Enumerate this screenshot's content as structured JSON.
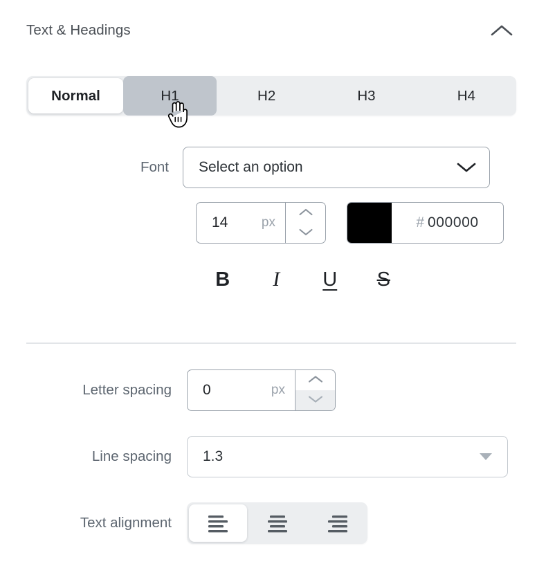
{
  "header": {
    "title": "Text & Headings",
    "collapse_icon": "chevron-up-icon"
  },
  "heading_tabs": {
    "items": [
      {
        "label": "Normal",
        "state": "active"
      },
      {
        "label": "H1",
        "state": "hover"
      },
      {
        "label": "H2",
        "state": "default"
      },
      {
        "label": "H3",
        "state": "default"
      },
      {
        "label": "H4",
        "state": "default"
      }
    ]
  },
  "font": {
    "label": "Font",
    "selected": "Select an option",
    "placeholder": "Select an option",
    "chevron_icon": "chevron-down-icon"
  },
  "font_size": {
    "value": "14",
    "unit": "px",
    "increment_icon": "chevron-up-icon",
    "decrement_icon": "chevron-down-icon"
  },
  "font_color": {
    "swatch": "#000000",
    "hash": "#",
    "hex": "000000"
  },
  "format_buttons": [
    {
      "name": "bold-button",
      "label": "B"
    },
    {
      "name": "italic-button",
      "label": "I"
    },
    {
      "name": "underline-button",
      "label": "U"
    },
    {
      "name": "strikethrough-button",
      "label": "S"
    }
  ],
  "letter_spacing": {
    "label": "Letter spacing",
    "value": "0",
    "unit": "px",
    "increment_icon": "chevron-up-icon",
    "decrement_icon": "chevron-down-icon"
  },
  "line_spacing": {
    "label": "Line spacing",
    "value": "1.3",
    "caret_icon": "caret-down-icon"
  },
  "text_alignment": {
    "label": "Text alignment",
    "options": [
      {
        "name": "align-left-button",
        "icon": "align-left-icon",
        "state": "active"
      },
      {
        "name": "align-center-button",
        "icon": "align-center-icon",
        "state": "default"
      },
      {
        "name": "align-right-button",
        "icon": "align-right-icon",
        "state": "default"
      }
    ]
  },
  "cursor": {
    "type": "pointer-hand-cursor"
  },
  "colors": {
    "panel_bg": "#ffffff",
    "title_text": "#4a4f55",
    "label_text": "#5d6670",
    "value_text": "#2e3338",
    "muted_text": "#9aa2ab",
    "group_bg": "#eceef0",
    "hover_bg": "#bfc5cc",
    "border": "#9aa2ab",
    "divider": "#e2e5e8"
  }
}
